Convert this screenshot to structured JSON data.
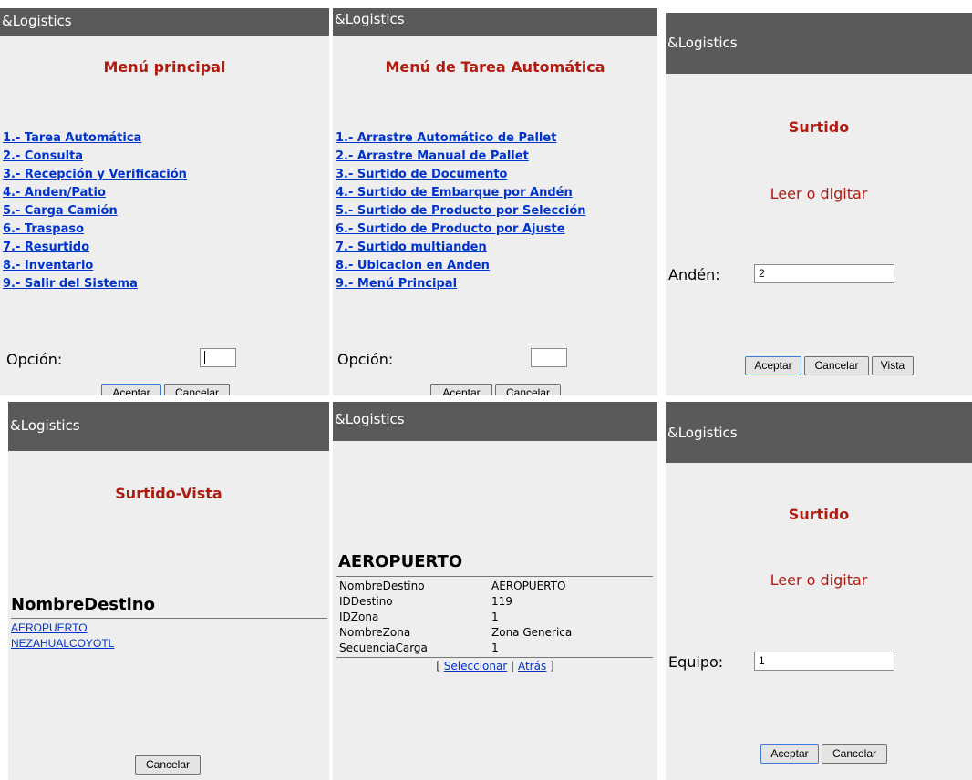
{
  "app_title": "&Logistics",
  "main_menu": {
    "title": "Menú principal",
    "items": [
      "1.- Tarea Automática",
      "2.- Consulta",
      "3.- Recepción y Verificación",
      "4.- Anden/Patio",
      "5.- Carga Camión",
      "6.- Traspaso",
      "7.- Resurtido",
      "8.- Inventario",
      "9.- Salir del Sistema"
    ],
    "option_label": "Opción:",
    "option_value": "",
    "accept_label": "Aceptar",
    "cancel_label": "Cancelar"
  },
  "auto_task_menu": {
    "title": "Menú de Tarea Automática",
    "items": [
      "1.- Arrastre Automático de Pallet",
      "2.- Arrastre Manual de Pallet",
      "3.- Surtido de Documento",
      "4.- Surtido de Embarque por Andén",
      "5.- Surtido de Producto por Selección",
      "6.- Surtido de Producto por Ajuste",
      "7.- Surtido multianden",
      "8.- Ubicacion en Anden",
      "9.- Menú Principal"
    ],
    "option_label": "Opción:",
    "option_value": "",
    "accept_label": "Aceptar",
    "cancel_label": "Cancelar"
  },
  "surtido_anden": {
    "title": "Surtido",
    "prompt": "Leer o digitar",
    "field_label": "Andén:",
    "field_value": "2",
    "accept_label": "Aceptar",
    "cancel_label": "Cancelar",
    "view_label": "Vista"
  },
  "surtido_vista": {
    "title": "Surtido-Vista",
    "header": "NombreDestino",
    "destinations": [
      "AEROPUERTO",
      "NEZAHUALCOYOTL"
    ],
    "cancel_label": "Cancelar"
  },
  "destino_detalle": {
    "title": "AEROPUERTO",
    "rows": [
      {
        "key": "NombreDestino",
        "value": "AEROPUERTO"
      },
      {
        "key": "IDDestino",
        "value": "119"
      },
      {
        "key": "IDZona",
        "value": "1"
      },
      {
        "key": "NombreZona",
        "value": "Zona Generica"
      },
      {
        "key": "SecuenciaCarga",
        "value": "1"
      }
    ],
    "nav_open": "[",
    "nav_sep": "|",
    "nav_close": "]",
    "select_label": "Seleccionar",
    "back_label": "Atrás"
  },
  "surtido_equipo": {
    "title": "Surtido",
    "prompt": "Leer o digitar",
    "field_label": "Equipo:",
    "field_value": "1",
    "accept_label": "Aceptar",
    "cancel_label": "Cancelar"
  }
}
